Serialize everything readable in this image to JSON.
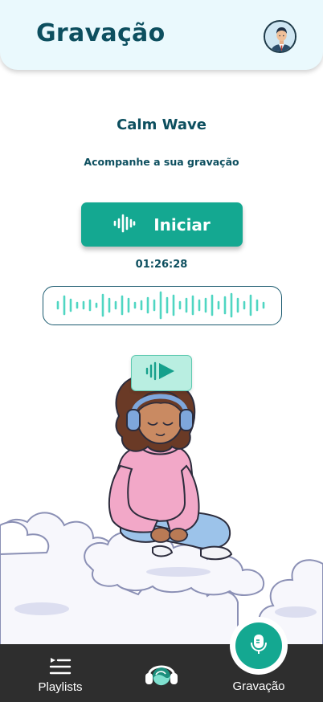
{
  "header": {
    "title": "Gravação",
    "avatar_icon": "user-avatar-icon"
  },
  "content": {
    "title": "Calm Wave",
    "subtitle": "Acompanhe a sua gravação"
  },
  "recorder": {
    "start_label": "Iniciar",
    "start_icon": "waveform-icon",
    "timer": "01:26:28",
    "play_icon": "play-audio-icon"
  },
  "tabbar": {
    "items": [
      {
        "label": "Playlists",
        "icon": "playlist-icon"
      },
      {
        "label": "",
        "icon": "headphones-logo-icon"
      },
      {
        "label": "Gravação",
        "icon": "microphone-icon"
      }
    ]
  },
  "colors": {
    "primary": "#14a891",
    "dark_text": "#0d4f5f",
    "header_bg": "#eaf9fd",
    "tabbar_bg": "#2e2e2e"
  }
}
